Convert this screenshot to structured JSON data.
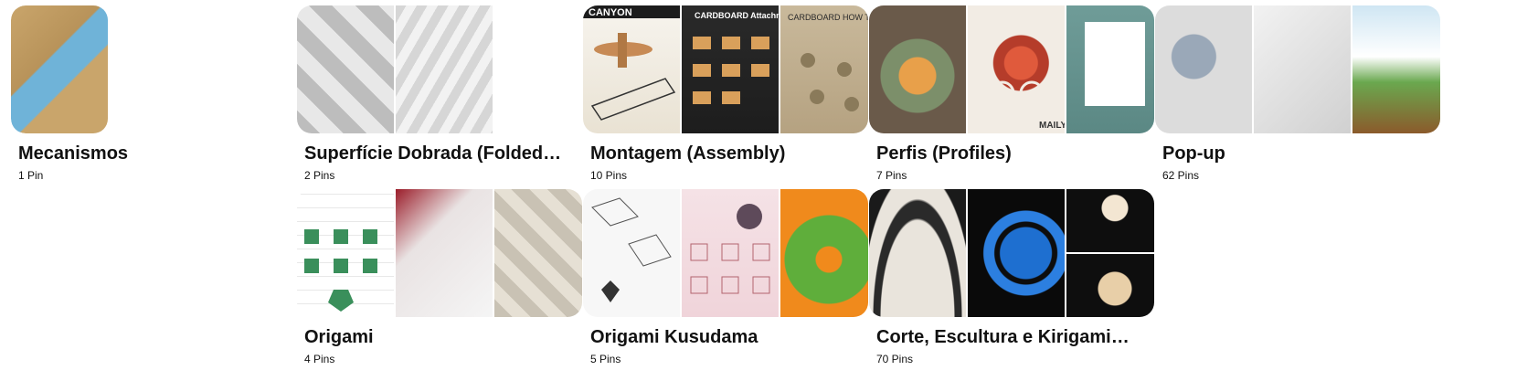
{
  "boards": [
    {
      "id": "mecanismos",
      "title": "Mecanismos",
      "count": "1 Pin",
      "layout": "single"
    },
    {
      "id": "superficie",
      "title": "Superfície Dobrada (Folded…",
      "count": "2 Pins",
      "layout": "triple"
    },
    {
      "id": "montagem",
      "title": "Montagem (Assembly)",
      "count": "10 Pins",
      "layout": "triple"
    },
    {
      "id": "perfis",
      "title": "Perfis (Profiles)",
      "count": "7 Pins",
      "layout": "triple"
    },
    {
      "id": "popup",
      "title": "Pop-up",
      "count": "62 Pins",
      "layout": "triple"
    },
    {
      "id": "origami",
      "title": "Origami",
      "count": "4 Pins",
      "layout": "triple"
    },
    {
      "id": "kusudama",
      "title": "Origami Kusudama",
      "count": "5 Pins",
      "layout": "triple"
    },
    {
      "id": "corte",
      "title": "Corte, Escultura e Kirigami…",
      "count": "70 Pins",
      "layout": "quad"
    }
  ],
  "cover_image_labels": {
    "montagem_1": "CANYON",
    "montagem_2": "CARDBOARD Attachments",
    "montagem_3": "CARDBOARD HOW TO ATTACH",
    "perfis_2": "MAILY"
  }
}
